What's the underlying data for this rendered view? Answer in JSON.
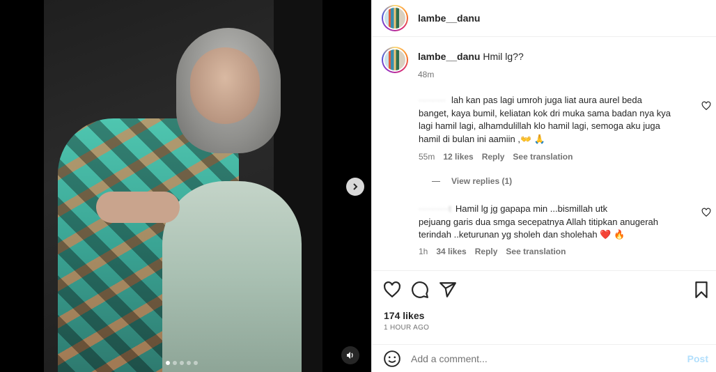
{
  "post": {
    "username": "lambe__danu",
    "caption_user": "lambe__danu",
    "caption_text": "Hmil lg??",
    "caption_time": "48m"
  },
  "media": {
    "slides": 5,
    "active_slide": 1
  },
  "comments": [
    {
      "user_hidden": "·········",
      "text_lines": [
        "lah kan pas lagi umroh juga liat aura aurel beda",
        "banget, kaya bumil, keliatan kok dri muka sama badan nya kya",
        "lagi hamil lagi, alhamdulillah klo hamil lagi, semoga aku juga",
        "hamil di bulan ini aamiin ,👐 🙏"
      ],
      "time": "55m",
      "likes": "12 likes",
      "reply": "Reply",
      "translate": "See translation",
      "view_replies": "View replies (1)"
    },
    {
      "user_hidden": "··········t",
      "text_lines": [
        "Hamil lg jg gapapa min ...bismillah utk",
        "pejuang garis dua smga secepatnya Allah titipkan anugerah",
        "terindah ..keturunan yg sholeh dan sholehah ❤️ 🔥"
      ],
      "time": "1h",
      "likes": "34 likes",
      "reply": "Reply",
      "translate": "See translation"
    }
  ],
  "footer": {
    "likes": "174 likes",
    "ago": "1 HOUR AGO",
    "comment_placeholder": "Add a comment...",
    "post_label": "Post"
  },
  "icons": [
    "heart-icon",
    "comment-icon",
    "share-icon",
    "bookmark-icon",
    "emoji-icon",
    "chevron-right-icon",
    "speaker-icon"
  ],
  "colors": {
    "link_blue_disabled": "#b2dffc",
    "muted": "#737373",
    "text": "#262626"
  }
}
